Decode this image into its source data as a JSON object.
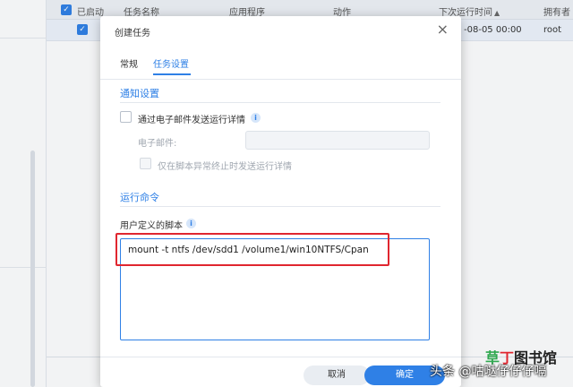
{
  "background_table": {
    "columns": [
      "已启动",
      "任务名称",
      "应用程序",
      "动作",
      "下次运行时间",
      "拥有者"
    ],
    "sort_indicator": "▲",
    "row": {
      "next_run": "-08-05 00:00",
      "owner": "root"
    }
  },
  "modal": {
    "title": "创建任务",
    "close_label": "×",
    "tabs": [
      {
        "label": "常规",
        "active": false
      },
      {
        "label": "任务设置",
        "active": true
      }
    ],
    "notification": {
      "section_title": "通知设置",
      "email_checkbox_label": "通过电子邮件发送运行详情",
      "email_field_label": "电子邮件:",
      "email_value": "",
      "abnormal_only_label": "仅在脚本异常终止时发送运行详情"
    },
    "run_command": {
      "section_title": "运行命令",
      "script_label": "用户定义的脚本",
      "script_value": "mount -t ntfs /dev/sdd1 /volume1/win10NTFS/Cpan"
    },
    "buttons": {
      "cancel": "取消",
      "ok": "确定"
    }
  },
  "info_glyph": "i",
  "check_glyph": "✓",
  "watermark": {
    "brand_part1": "草",
    "brand_part2": "丁",
    "brand_part3": "图书馆",
    "sub": "头条 @咕哒仔仔仔嗝"
  },
  "colors": {
    "accent": "#2f80e6",
    "highlight": "#e0262f"
  }
}
